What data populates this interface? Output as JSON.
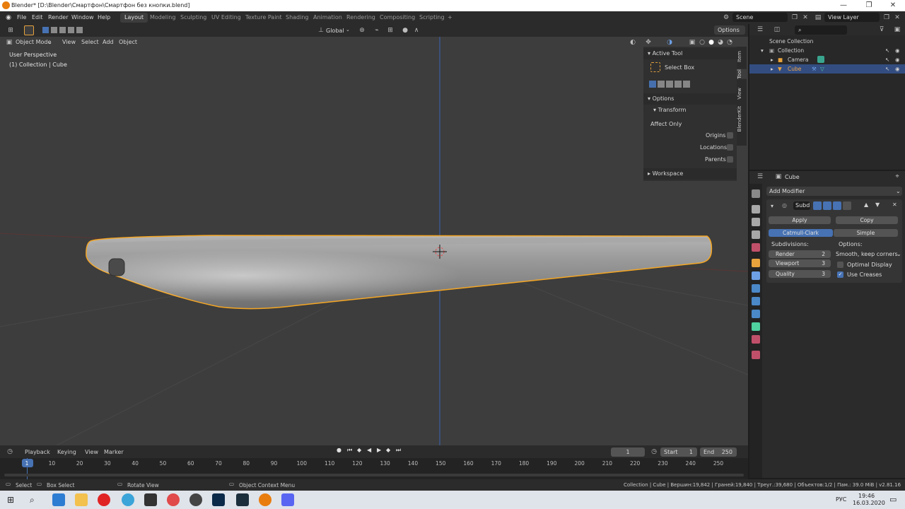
{
  "window": {
    "title": "Blender* [D:\\Blender\\Смартфон\\Смартфон без кнопки.blend]"
  },
  "menu": [
    "File",
    "Edit",
    "Render",
    "Window",
    "Help"
  ],
  "workspaces": [
    "Layout",
    "Modeling",
    "Sculpting",
    "UV Editing",
    "Texture Paint",
    "Shading",
    "Animation",
    "Rendering",
    "Compositing",
    "Scripting"
  ],
  "active_workspace": "Layout",
  "scene": {
    "name": "Scene",
    "view_layer": "View Layer"
  },
  "toolbar": {
    "orientation": "Global",
    "options": "Options"
  },
  "viewport": {
    "mode": "Object Mode",
    "menus": [
      "View",
      "Select",
      "Add",
      "Object"
    ],
    "overlay_title": "User Perspective",
    "overlay_sub": "(1) Collection | Cube"
  },
  "npanel": {
    "active_tool": "Active Tool",
    "tool_name": "Select Box",
    "options": "Options",
    "transform": "Transform",
    "affect_only": "Affect Only",
    "origins": "Origins",
    "locations": "Locations",
    "parents": "Parents",
    "workspace": "Workspace",
    "tabs": [
      "Item",
      "Tool",
      "View",
      "BlenderKit"
    ]
  },
  "outliner": {
    "scene_collection": "Scene Collection",
    "collection": "Collection",
    "camera": "Camera",
    "cube": "Cube"
  },
  "properties": {
    "object": "Cube",
    "add_modifier": "Add Modifier",
    "modifier_name": "Subd",
    "apply": "Apply",
    "copy": "Copy",
    "catmull": "Catmull-Clark",
    "simple": "Simple",
    "subdivisions": "Subdivisions:",
    "options_label": "Options:",
    "render_label": "Render",
    "render_val": "2",
    "viewport_label": "Viewport",
    "viewport_val": "3",
    "quality_label": "Quality",
    "quality_val": "3",
    "uv_smooth": "Smooth, keep corners",
    "optimal": "Optimal Display",
    "use_creases": "Use Creases"
  },
  "timeline": {
    "menus": [
      "Playback",
      "Keying",
      "View",
      "Marker"
    ],
    "current": "1",
    "start_label": "Start",
    "start": "1",
    "end_label": "End",
    "end": "250",
    "ticks": [
      "1",
      "10",
      "20",
      "30",
      "40",
      "50",
      "60",
      "70",
      "80",
      "90",
      "100",
      "110",
      "120",
      "130",
      "140",
      "150",
      "160",
      "170",
      "180",
      "190",
      "200",
      "210",
      "220",
      "230",
      "240",
      "250"
    ]
  },
  "status": {
    "select": "Select",
    "box_select": "Box Select",
    "rotate": "Rotate View",
    "context": "Object Context Menu",
    "stats": "Collection | Cube | Вершин:19,842 | Граней:19,840 | Треуг.:39,680 | Объектов:1/2 | Пам.: 39.0 MiB | v2.81.16"
  },
  "taskbar": {
    "lang": "РУС",
    "time": "19:46",
    "date": "16.03.2020"
  },
  "colors": {
    "accent": "#4772b3",
    "selection": "#f5a623",
    "blender": "#e87d0d"
  }
}
